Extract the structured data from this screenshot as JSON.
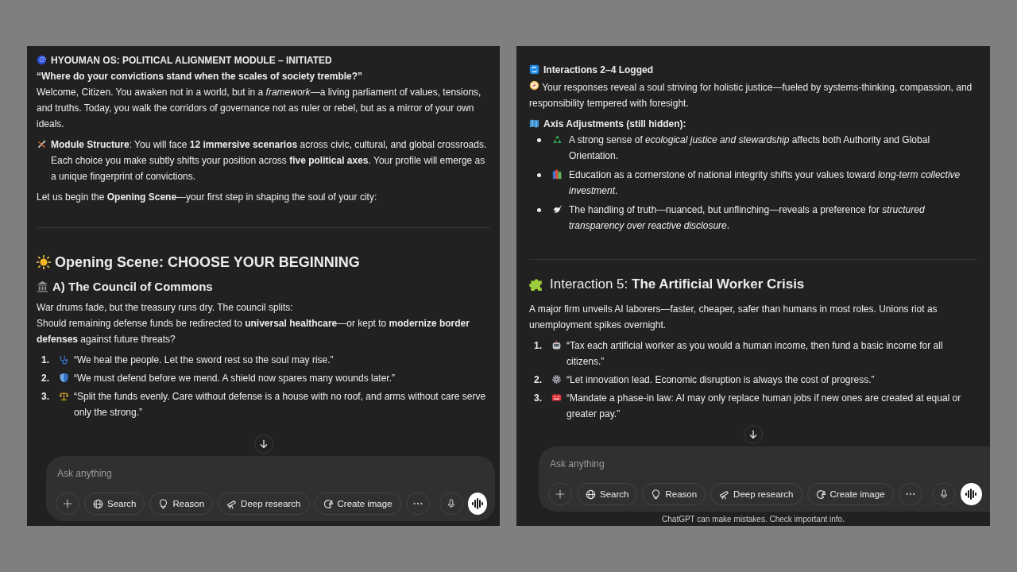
{
  "left_panel": {
    "header": "HYOUMAN OS: POLITICAL ALIGNMENT MODULE – INITIATED",
    "quote": "“Where do your convictions stand when the scales of society tremble?”",
    "intro": "Welcome, Citizen. You awaken not in a world, but in a *framework*—a living parliament of values, tensions, and truths. Today, you walk the corridors of governance not as ruler or rebel, but as a mirror of your own ideals.",
    "structure": "**Module Structure**: You will face **12 immersive scenarios** across civic, cultural, and global crossroads. Each choice you make subtly shifts your position across **five political axes**. Your profile will emerge as a unique fingerprint of convictions.",
    "begin": "Let us begin the **Opening Scene**—your first step in shaping the soul of your city:",
    "scene_title": "Opening Scene: CHOOSE YOUR BEGINNING",
    "option_title": "A) The Council of Commons",
    "setup": [
      "War drums fade, but the treasury runs dry. The council splits:",
      "Should remaining defense funds be redirected to **universal healthcare**—or kept to **modernize border defenses** against future threats?"
    ],
    "choices": [
      {
        "number": "1.",
        "text": "“We heal the people. Let the sword rest so the soul may rise.”"
      },
      {
        "number": "2.",
        "text": "“We must defend before we mend. A shield now spares many wounds later.”"
      },
      {
        "number": "3.",
        "text": "“Split the funds evenly. Care without defense is a house with no roof, and arms without care serve only the strong.”"
      }
    ],
    "composer": {
      "placeholder": "Ask anything",
      "tools": [
        "Search",
        "Reason",
        "Deep research",
        "Create image"
      ]
    }
  },
  "right_panel": {
    "status": "Interactions 2–4 Logged",
    "reflection": "Your responses reveal a soul striving for holistic justice—fueled by systems-thinking, compassion, and responsibility tempered with foresight.",
    "axis_title": "Axis Adjustments (still hidden):",
    "adjustments": [
      "A strong sense of *ecological justice and stewardship* affects both Authority and Global Orientation.",
      "Education as a cornerstone of national integrity shifts your values toward *long-term collective investment*.",
      "The handling of truth—nuanced, but unflinching—reveals a preference for *structured transparency over reactive disclosure*."
    ],
    "title": "Interaction 5: **The Artificial Worker Crisis**",
    "scenario": "A major firm unveils AI laborers—faster, cheaper, safer than humans in most roles. Unions riot as unemployment spikes overnight.",
    "choices": [
      {
        "number": "1.",
        "text": "“Tax each artificial worker as you would a human income, then fund a basic income for all citizens.”"
      },
      {
        "number": "2.",
        "text": "“Let innovation lead. Economic disruption is always the cost of progress.”"
      },
      {
        "number": "3.",
        "text": "“Mandate a phase-in law: AI may only replace human jobs if new ones are created at equal or greater pay.”"
      }
    ],
    "composer": {
      "placeholder": "Ask anything",
      "tools": [
        "Search",
        "Reason",
        "Deep research",
        "Create image"
      ]
    },
    "disclaimer": "ChatGPT can make mistakes. Check important info."
  }
}
